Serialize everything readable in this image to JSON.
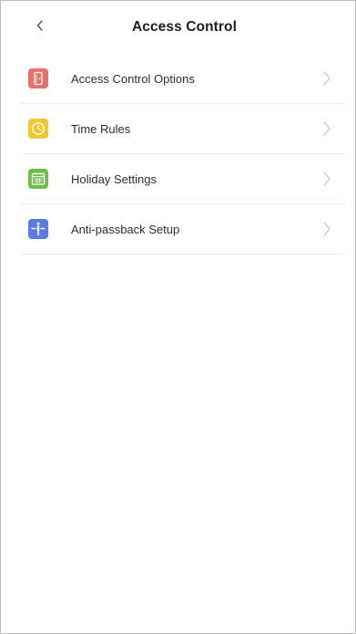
{
  "header": {
    "title": "Access Control",
    "back_icon": "chevron-left-icon"
  },
  "menu": {
    "items": [
      {
        "label": "Access Control Options",
        "icon": "door-icon",
        "color": "#e8706a"
      },
      {
        "label": "Time Rules",
        "icon": "clock-icon",
        "color": "#f2c832"
      },
      {
        "label": "Holiday Settings",
        "icon": "calendar-icon",
        "color": "#6cc04a"
      },
      {
        "label": "Anti-passback Setup",
        "icon": "anti-passback-icon",
        "color": "#5b7be3"
      }
    ]
  },
  "colors": {
    "background": "#ffffff",
    "divider": "#ececec",
    "title_text": "#1e1e1e",
    "item_text": "#2e2e2e",
    "chevron": "#c4c4c4"
  }
}
